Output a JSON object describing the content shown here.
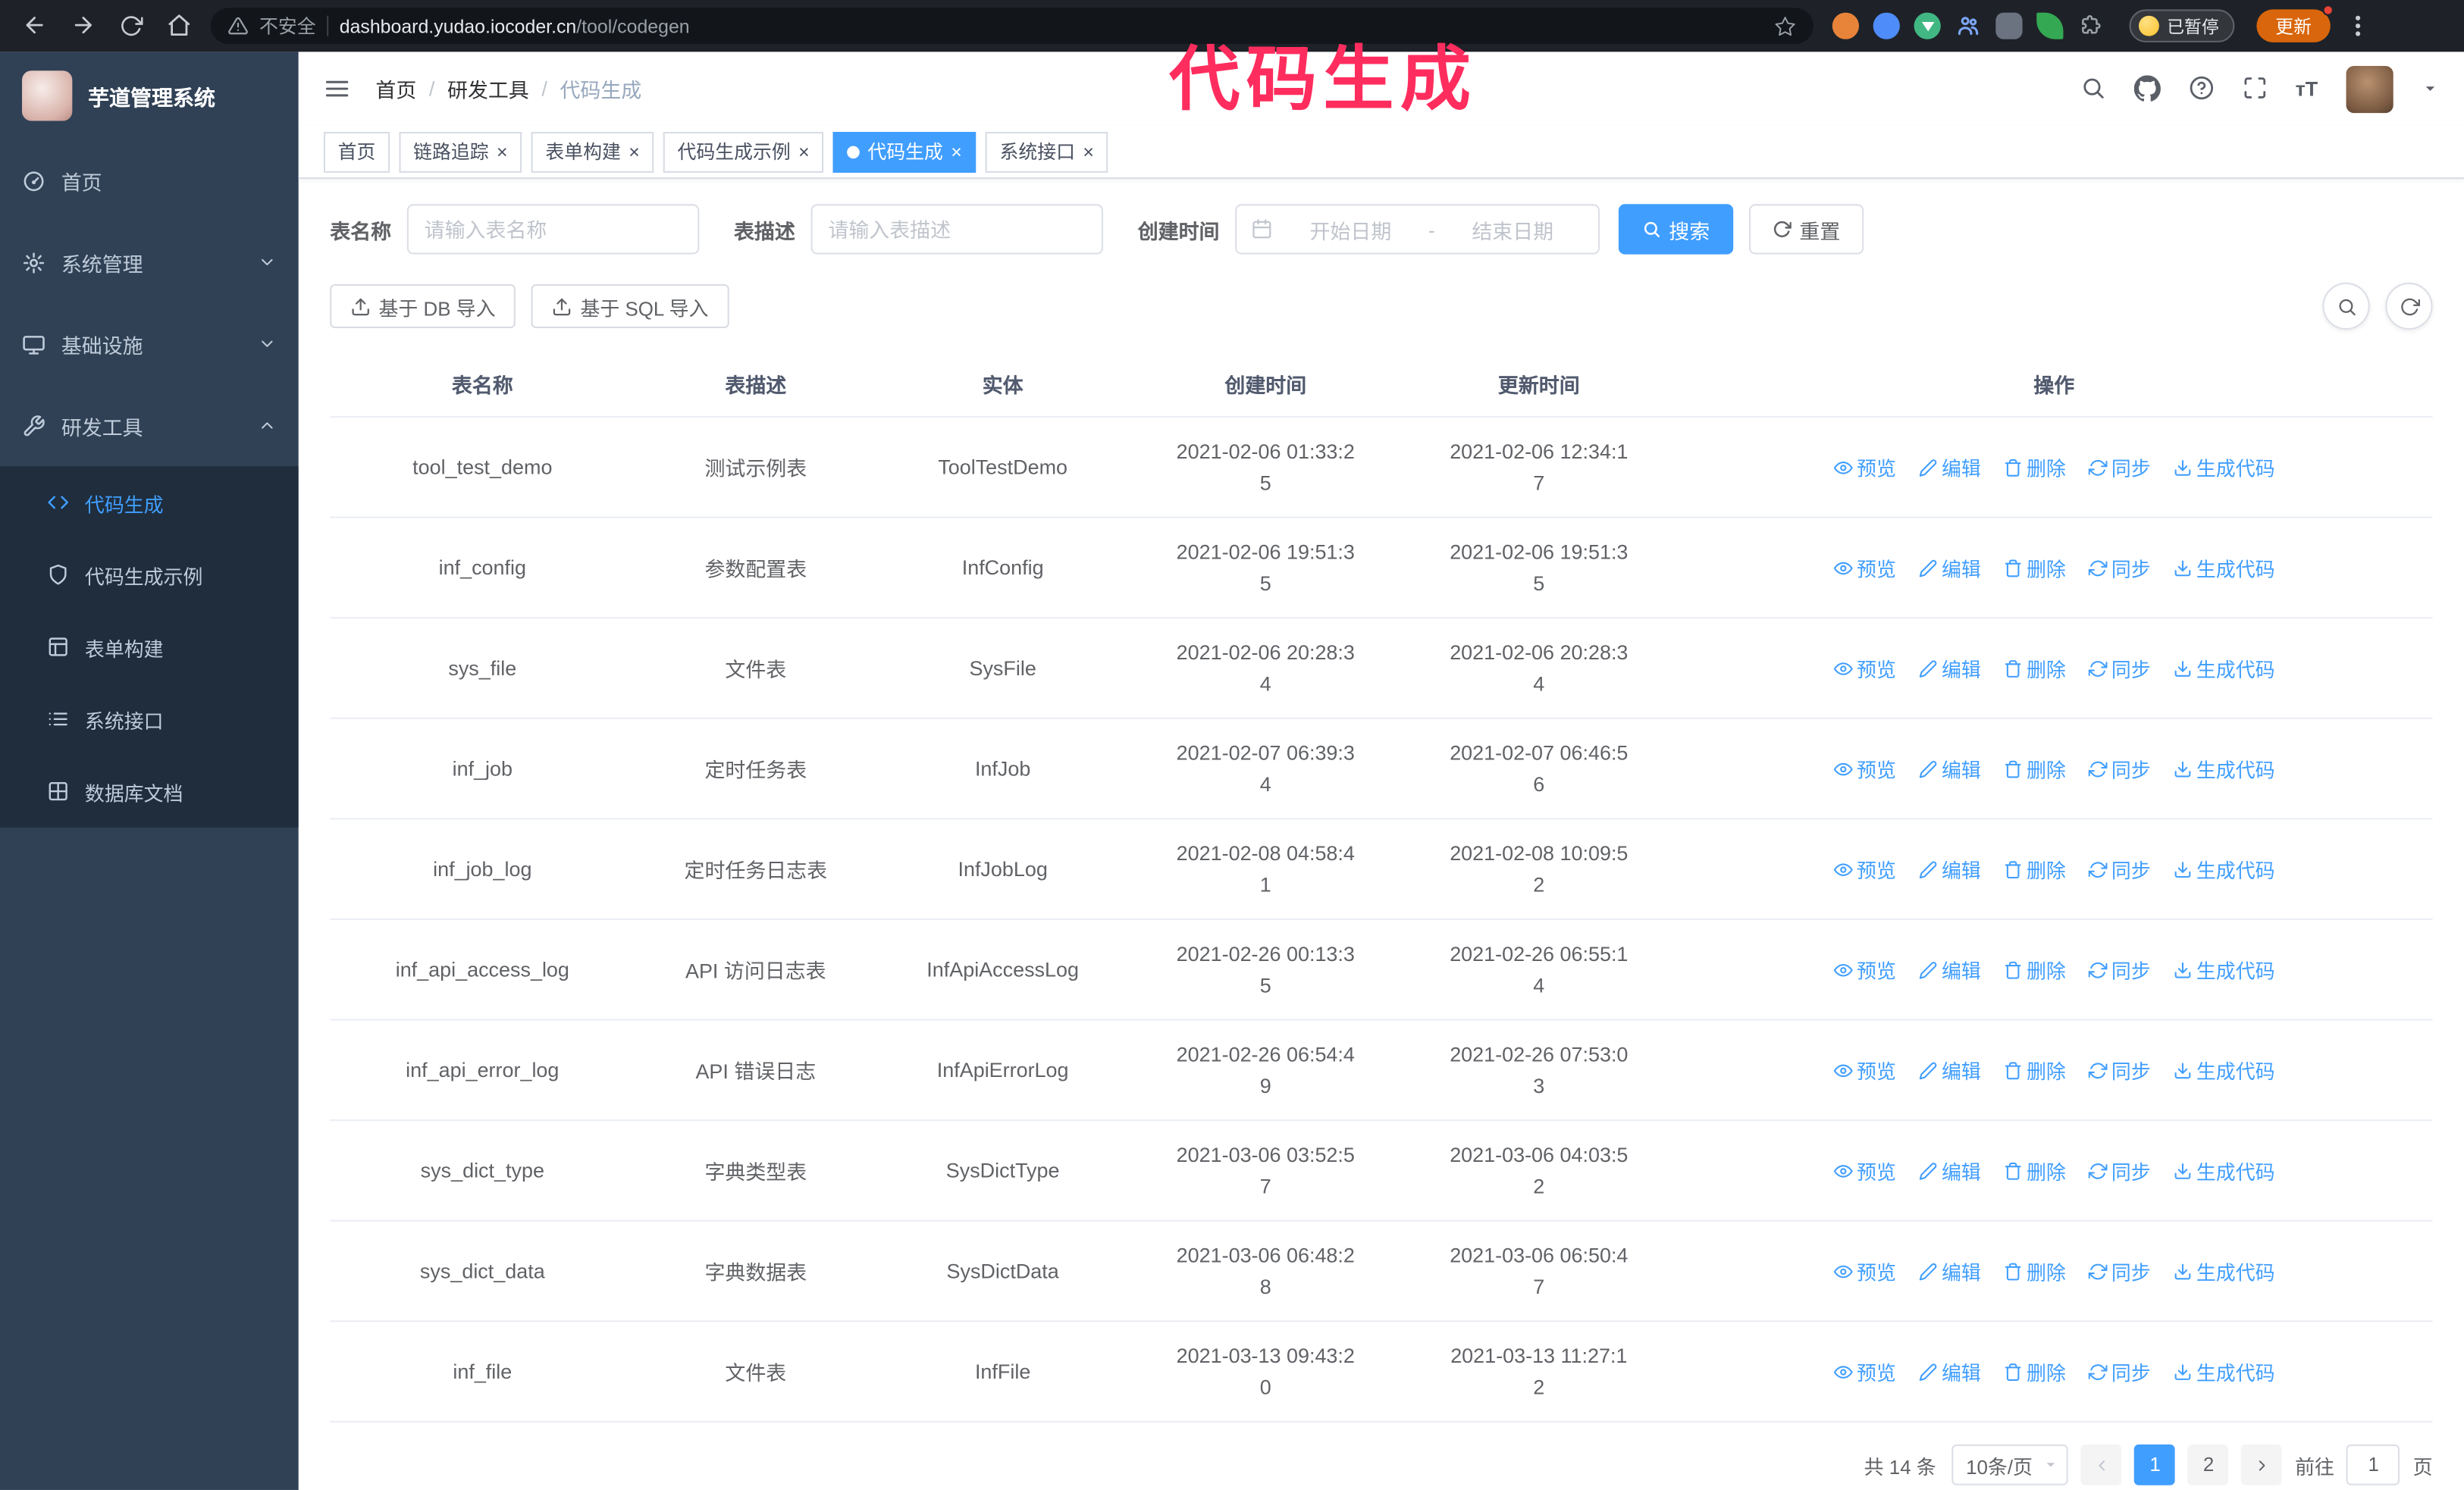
{
  "browser": {
    "security_warning": "不安全",
    "url_host": "dashboard.yudao.iocoder.cn",
    "url_path": "/tool/codegen",
    "paused_badge": "已暂停",
    "update_button": "更新"
  },
  "annotation": {
    "text": "代码生成",
    "color": "#ff2d5e"
  },
  "sidebar": {
    "logo_title": "芋道管理系统",
    "items": [
      {
        "label": "首页"
      },
      {
        "label": "系统管理"
      },
      {
        "label": "基础设施"
      },
      {
        "label": "研发工具"
      }
    ],
    "sub_items": [
      {
        "label": "代码生成",
        "active": true
      },
      {
        "label": "代码生成示例"
      },
      {
        "label": "表单构建"
      },
      {
        "label": "系统接口"
      },
      {
        "label": "数据库文档"
      }
    ]
  },
  "header": {
    "separator": "/",
    "breadcrumb": [
      "首页",
      "研发工具",
      "代码生成"
    ]
  },
  "tabs": [
    {
      "label": "首页",
      "closable": false,
      "active": false
    },
    {
      "label": "链路追踪",
      "closable": true,
      "active": false
    },
    {
      "label": "表单构建",
      "closable": true,
      "active": false
    },
    {
      "label": "代码生成示例",
      "closable": true,
      "active": false
    },
    {
      "label": "代码生成",
      "closable": true,
      "active": true
    },
    {
      "label": "系统接口",
      "closable": true,
      "active": false
    }
  ],
  "filters": {
    "name_label": "表名称",
    "name_placeholder": "请输入表名称",
    "desc_label": "表描述",
    "desc_placeholder": "请输入表描述",
    "time_label": "创建时间",
    "start_placeholder": "开始日期",
    "range_separator": "-",
    "end_placeholder": "结束日期",
    "search_label": "搜索",
    "reset_label": "重置"
  },
  "toolbar": {
    "import_db": "基于 DB 导入",
    "import_sql": "基于 SQL 导入"
  },
  "table": {
    "columns": [
      "表名称",
      "表描述",
      "实体",
      "创建时间",
      "更新时间",
      "操作"
    ],
    "op_labels": [
      "预览",
      "编辑",
      "删除",
      "同步",
      "生成代码"
    ],
    "rows": [
      {
        "name": "tool_test_demo",
        "desc": "测试示例表",
        "entity": "ToolTestDemo",
        "created": "2021-02-06 01:33:25",
        "updated": "2021-02-06 12:34:17"
      },
      {
        "name": "inf_config",
        "desc": "参数配置表",
        "entity": "InfConfig",
        "created": "2021-02-06 19:51:35",
        "updated": "2021-02-06 19:51:35"
      },
      {
        "name": "sys_file",
        "desc": "文件表",
        "entity": "SysFile",
        "created": "2021-02-06 20:28:34",
        "updated": "2021-02-06 20:28:34"
      },
      {
        "name": "inf_job",
        "desc": "定时任务表",
        "entity": "InfJob",
        "created": "2021-02-07 06:39:34",
        "updated": "2021-02-07 06:46:56"
      },
      {
        "name": "inf_job_log",
        "desc": "定时任务日志表",
        "entity": "InfJobLog",
        "created": "2021-02-08 04:58:41",
        "updated": "2021-02-08 10:09:52"
      },
      {
        "name": "inf_api_access_log",
        "desc": "API 访问日志表",
        "entity": "InfApiAccessLog",
        "created": "2021-02-26 00:13:35",
        "updated": "2021-02-26 06:55:14"
      },
      {
        "name": "inf_api_error_log",
        "desc": "API 错误日志",
        "entity": "InfApiErrorLog",
        "created": "2021-02-26 06:54:49",
        "updated": "2021-02-26 07:53:03"
      },
      {
        "name": "sys_dict_type",
        "desc": "字典类型表",
        "entity": "SysDictType",
        "created": "2021-03-06 03:52:57",
        "updated": "2021-03-06 04:03:52"
      },
      {
        "name": "sys_dict_data",
        "desc": "字典数据表",
        "entity": "SysDictData",
        "created": "2021-03-06 06:48:28",
        "updated": "2021-03-06 06:50:47"
      },
      {
        "name": "inf_file",
        "desc": "文件表",
        "entity": "InfFile",
        "created": "2021-03-13 09:43:20",
        "updated": "2021-03-13 11:27:12"
      }
    ]
  },
  "pagination": {
    "total": "共 14 条",
    "page_size": "10条/页",
    "pages": [
      "1",
      "2"
    ],
    "active_page": "1",
    "goto_label": "前往",
    "goto_value": "1",
    "page_suffix": "页"
  }
}
